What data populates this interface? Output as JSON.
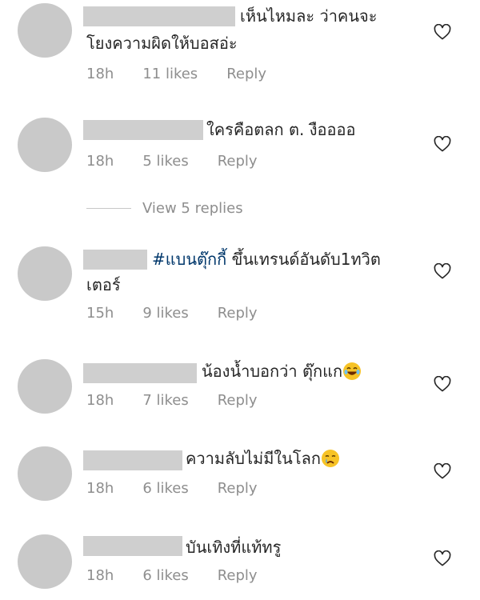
{
  "comments": [
    {
      "text_line1": "เห็นไหมละ ว่าคนจะ",
      "text_line2": "โยงความผิดให้บอสอ่ะ",
      "time": "18h",
      "likes": "11 likes",
      "reply": "Reply"
    },
    {
      "text_line1": "ใครคือตลก ต. งืออออ",
      "time": "18h",
      "likes": "5 likes",
      "reply": "Reply"
    },
    {
      "hashtag": "#แบนตุ๊กกี้",
      "text_line1": " ขึ้นเทรนด์อันดับ1ทวิต",
      "text_line2": "เตอร์",
      "time": "15h",
      "likes": "9 likes",
      "reply": "Reply"
    },
    {
      "text_line1": "น้องน้ำบอกว่า ตุ๊กแก",
      "emoji": "laughing-emoji",
      "time": "18h",
      "likes": "7 likes",
      "reply": "Reply"
    },
    {
      "text_line1": "ความลับไม่มีในโลก",
      "emoji": "crying-emoji",
      "time": "18h",
      "likes": "6 likes",
      "reply": "Reply"
    },
    {
      "text_line1": "บันเทิงที่แท้ทรู",
      "time": "18h",
      "likes": "6 likes",
      "reply": "Reply"
    }
  ],
  "view_replies": "View 5 replies",
  "colors": {
    "text": "#262626",
    "meta": "#8e8e8e",
    "hashtag": "#00376b",
    "redaction": "#cfcfcf",
    "avatar": "#c9c9c9"
  }
}
